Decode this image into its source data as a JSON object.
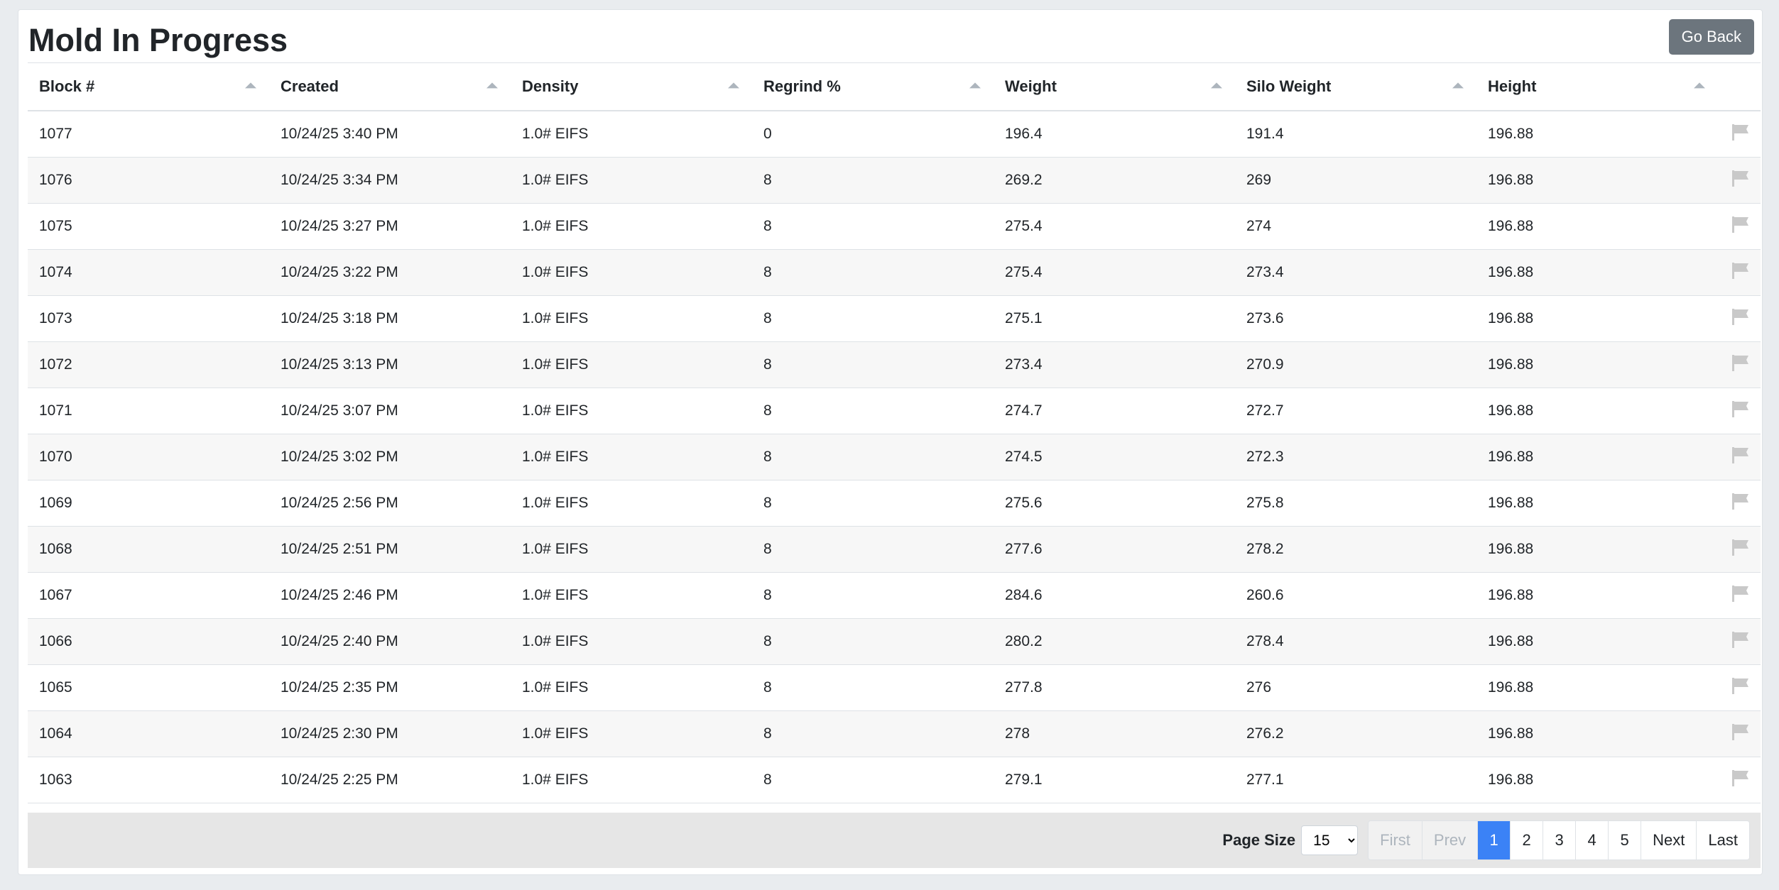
{
  "header": {
    "title": "Mold In Progress",
    "go_back_label": "Go Back"
  },
  "table": {
    "columns": [
      "Block #",
      "Created",
      "Density",
      "Regrind %",
      "Weight",
      "Silo Weight",
      "Height"
    ],
    "rows": [
      [
        "1077",
        "10/24/25 3:40 PM",
        "1.0# EIFS",
        "0",
        "196.4",
        "191.4",
        "196.88"
      ],
      [
        "1076",
        "10/24/25 3:34 PM",
        "1.0# EIFS",
        "8",
        "269.2",
        "269",
        "196.88"
      ],
      [
        "1075",
        "10/24/25 3:27 PM",
        "1.0# EIFS",
        "8",
        "275.4",
        "274",
        "196.88"
      ],
      [
        "1074",
        "10/24/25 3:22 PM",
        "1.0# EIFS",
        "8",
        "275.4",
        "273.4",
        "196.88"
      ],
      [
        "1073",
        "10/24/25 3:18 PM",
        "1.0# EIFS",
        "8",
        "275.1",
        "273.6",
        "196.88"
      ],
      [
        "1072",
        "10/24/25 3:13 PM",
        "1.0# EIFS",
        "8",
        "273.4",
        "270.9",
        "196.88"
      ],
      [
        "1071",
        "10/24/25 3:07 PM",
        "1.0# EIFS",
        "8",
        "274.7",
        "272.7",
        "196.88"
      ],
      [
        "1070",
        "10/24/25 3:02 PM",
        "1.0# EIFS",
        "8",
        "274.5",
        "272.3",
        "196.88"
      ],
      [
        "1069",
        "10/24/25 2:56 PM",
        "1.0# EIFS",
        "8",
        "275.6",
        "275.8",
        "196.88"
      ],
      [
        "1068",
        "10/24/25 2:51 PM",
        "1.0# EIFS",
        "8",
        "277.6",
        "278.2",
        "196.88"
      ],
      [
        "1067",
        "10/24/25 2:46 PM",
        "1.0# EIFS",
        "8",
        "284.6",
        "260.6",
        "196.88"
      ],
      [
        "1066",
        "10/24/25 2:40 PM",
        "1.0# EIFS",
        "8",
        "280.2",
        "278.4",
        "196.88"
      ],
      [
        "1065",
        "10/24/25 2:35 PM",
        "1.0# EIFS",
        "8",
        "277.8",
        "276",
        "196.88"
      ],
      [
        "1064",
        "10/24/25 2:30 PM",
        "1.0# EIFS",
        "8",
        "278",
        "276.2",
        "196.88"
      ],
      [
        "1063",
        "10/24/25 2:25 PM",
        "1.0# EIFS",
        "8",
        "279.1",
        "277.1",
        "196.88"
      ]
    ],
    "row_icon": "flag-icon"
  },
  "pagination": {
    "page_size_label": "Page Size",
    "page_size_value": "15",
    "first_label": "First",
    "prev_label": "Prev",
    "pages": [
      "1",
      "2",
      "3",
      "4",
      "5"
    ],
    "active_page": "1",
    "next_label": "Next",
    "last_label": "Last"
  },
  "colors": {
    "accent": "#3b82f6",
    "secondary_button": "#6c757d",
    "footer_bg": "#e6e6e6"
  }
}
